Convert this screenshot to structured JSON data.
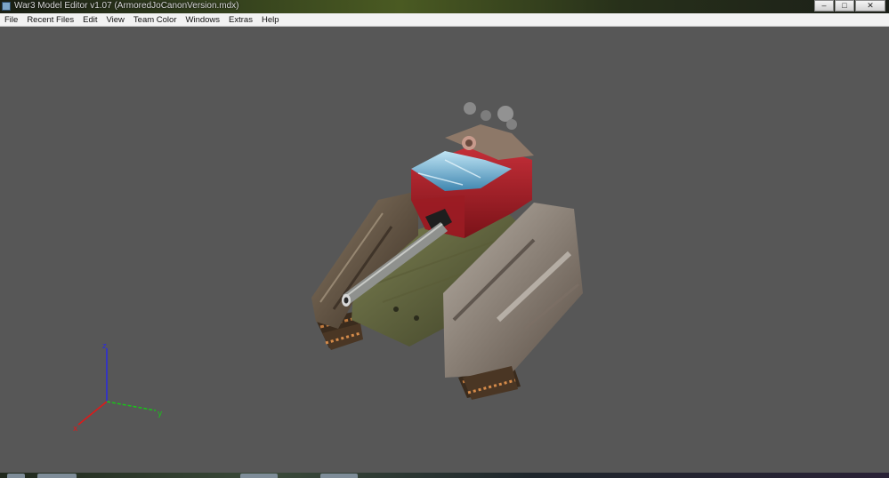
{
  "window": {
    "title": "War3 Model Editor v1.07 (ArmoredJoCanonVersion.mdx)",
    "controls": {
      "minimize": "–",
      "maximize": "□",
      "close": "✕"
    }
  },
  "menu": [
    {
      "label": "File"
    },
    {
      "label": "Recent Files"
    },
    {
      "label": "Edit"
    },
    {
      "label": "View"
    },
    {
      "label": "Team Color"
    },
    {
      "label": "Windows"
    },
    {
      "label": "Extras"
    },
    {
      "label": "Help"
    }
  ],
  "viewport": {
    "background": "#575757",
    "axes": {
      "x_label": "x",
      "y_label": "y",
      "z_label": "z",
      "x_color": "#e01818",
      "y_color": "#19c419",
      "z_color": "#2a2ae0"
    }
  }
}
